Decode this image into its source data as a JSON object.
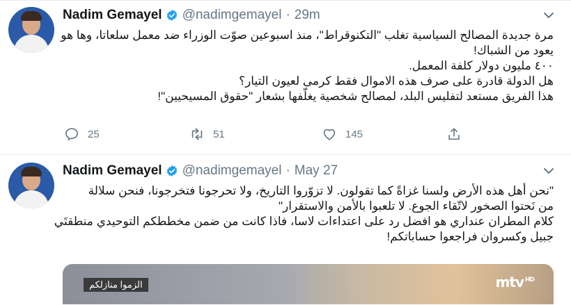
{
  "colors": {
    "accent": "#1da1f2",
    "muted": "#657786",
    "text": "#14171a",
    "divider": "#e6ecf0"
  },
  "tweets": [
    {
      "author": "Nadim Gemayel",
      "handle": "@nadimgemayel",
      "separator": "·",
      "time": "29m",
      "lines": [
        "مرة جديدة المصالح السياسية تغلب \"التكنوقراط\"، منذ اسبوعين صوّت الوزراء ضد معمل سلعاتا، وها هو",
        "يعود من الشباك!",
        "٤٠٠ مليون دولار كلفة المعمل.",
        "هل الدولة قادرة على صرف هذه الاموال فقط كرمى لعيون التيار؟",
        "هذا الفريق مستعد لتفليس البلد، لمصالح شخصية يغلّفها بشعار \"حقوق المسيحيين\"!"
      ],
      "actions": {
        "reply_count": "25",
        "retweet_count": "51",
        "like_count": "145"
      },
      "icons": [
        "reply-icon",
        "retweet-icon",
        "like-icon",
        "share-icon",
        "verified-icon",
        "chevron-down-icon"
      ]
    },
    {
      "author": "Nadim Gemayel",
      "handle": "@nadimgemayel",
      "separator": "·",
      "time": "May 27",
      "lines": [
        "\"نحن أهل هذه الأرض ولسنا غزاةً كما تقولون. لا تزوّروا التاريخ، ولا تحرجونا فتخرجونا، فنحن سلالة",
        "من نَحتوا الصخور لاتّقاء الجوع. لا تلعبوا بالأمن والاستقرار\"",
        "كلام المطران عنداري هو افضل رد على اعتداءات لاسا، فاذا كانت من ضمن مخططكم التوحيدي منطقتَي",
        "جبيل وكسروان فراجعوا حساباتكم!"
      ],
      "media": {
        "caption": "الزموا منازلكم",
        "logo": "mtv",
        "logo_badge": "HD"
      }
    }
  ]
}
